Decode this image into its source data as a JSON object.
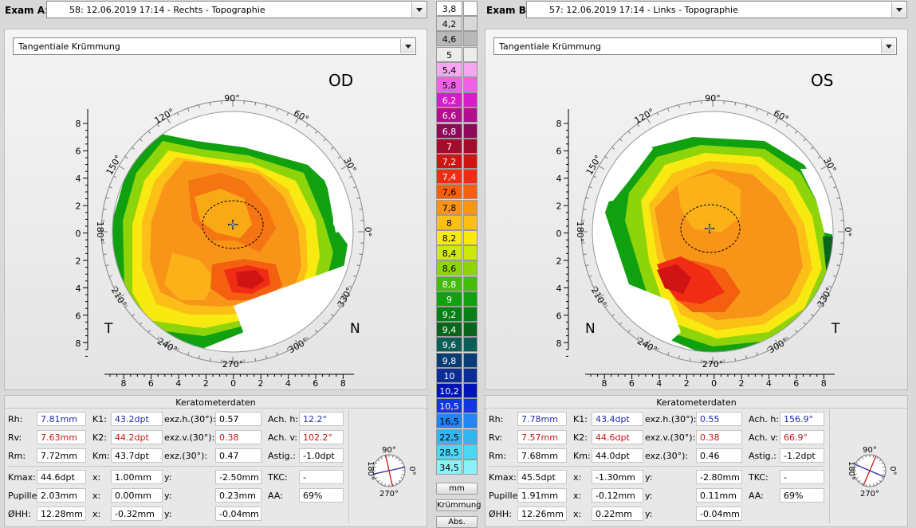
{
  "examA": {
    "label": "Exam A:",
    "value": "58: 12.06.2019 17:14 - Rechts - Topographie"
  },
  "examB": {
    "label": "Exam B:",
    "value": "57: 12.06.2019 17:14 - Links - Topographie"
  },
  "mapA": {
    "type": "Tangentiale Krümmung",
    "eye": "OD",
    "left_corner": "T",
    "right_corner": "N"
  },
  "mapB": {
    "type": "Tangentiale Krümmung",
    "eye": "OS",
    "left_corner": "N",
    "right_corner": "T"
  },
  "angles": {
    "a90": "90°",
    "a60": "60°",
    "a30": "30°",
    "a0": "0°",
    "a330": "330°",
    "a300": "300°",
    "a270": "270°",
    "a240": "240°",
    "a210": "210°",
    "a180": "180°",
    "a150": "150°",
    "a120": "120°"
  },
  "axis_ticks": [
    "8",
    "6",
    "4",
    "2",
    "0",
    "2",
    "4",
    "6",
    "8"
  ],
  "scale": [
    {
      "v": "3,8",
      "c": "#ffffff"
    },
    {
      "v": "4,2",
      "c": "#d8d8d8"
    },
    {
      "v": "4,6",
      "c": "#b8b8b8"
    },
    {
      "v": "5",
      "c": "#ececec"
    },
    {
      "v": "5,4",
      "c": "#f7a6f0"
    },
    {
      "v": "5,8",
      "c": "#f060e8"
    },
    {
      "v": "6,2",
      "c": "#d81cc8"
    },
    {
      "v": "6,6",
      "c": "#b0108c"
    },
    {
      "v": "6,8",
      "c": "#8c0a58"
    },
    {
      "v": "7",
      "c": "#a00c2c"
    },
    {
      "v": "7,2",
      "c": "#d01414"
    },
    {
      "v": "7,4",
      "c": "#f02c14"
    },
    {
      "v": "7,6",
      "c": "#f46010"
    },
    {
      "v": "7,8",
      "c": "#f89418"
    },
    {
      "v": "8",
      "c": "#fbbf18"
    },
    {
      "v": "8,2",
      "c": "#f8ea10"
    },
    {
      "v": "8,4",
      "c": "#cde80c"
    },
    {
      "v": "8,6",
      "c": "#8ed40a"
    },
    {
      "v": "8,8",
      "c": "#44bc08"
    },
    {
      "v": "9",
      "c": "#10a010"
    },
    {
      "v": "9,2",
      "c": "#0a7c18"
    },
    {
      "v": "9,4",
      "c": "#0a641c"
    },
    {
      "v": "9,6",
      "c": "#0c5c58"
    },
    {
      "v": "9,8",
      "c": "#0a3c74"
    },
    {
      "v": "10",
      "c": "#0a2c94"
    },
    {
      "v": "10,2",
      "c": "#0014b4"
    },
    {
      "v": "10,5",
      "c": "#1038e0"
    },
    {
      "v": "16,5",
      "c": "#2484f0"
    },
    {
      "v": "22,5",
      "c": "#34b4f0"
    },
    {
      "v": "28,5",
      "c": "#4cd8f4"
    },
    {
      "v": "34,5",
      "c": "#8cf0f8"
    }
  ],
  "buttons": {
    "mm": "mm",
    "kruemmung": "Krümmung",
    "abs": "Abs."
  },
  "keratoA": {
    "title": "Keratometerdaten",
    "Rh_l": "Rh:",
    "Rh": "7.81mm",
    "Rv_l": "Rv:",
    "Rv": "7.63mm",
    "Rm_l": "Rm:",
    "Rm": "7.72mm",
    "K1_l": "K1:",
    "K1": "43.2dpt",
    "K2_l": "K2:",
    "K2": "44.2dpt",
    "Km_l": "Km:",
    "Km": "43.7dpt",
    "exzh_l": "exz.h.(30°):",
    "exzh": "0.57",
    "exzv_l": "exz.v.(30°):",
    "exzv": "0.38",
    "exz_l": "exz.(30°):",
    "exz": "0.47",
    "achh_l": "Ach. h:",
    "achh": "12.2°",
    "achv_l": "Ach. v:",
    "achv": "102.2°",
    "astig_l": "Astig.:",
    "astig": "-1.0dpt",
    "kmax_l": "Kmax:",
    "kmax": "44.6dpt",
    "kmax_x_l": "x:",
    "kmax_x": "1.00mm",
    "kmax_y_l": "y:",
    "kmax_y": "-2.50mm",
    "pup_l": "Pupille:",
    "pup": "2.03mm",
    "pup_x_l": "x:",
    "pup_x": "0.00mm",
    "pup_y_l": "y:",
    "pup_y": "0.23mm",
    "hh_l": "ØHH:",
    "hh": "12.28mm",
    "hh_x_l": "x:",
    "hh_x": "-0.32mm",
    "hh_y_l": "y:",
    "hh_y": "-0.04mm",
    "tkc_l": "TKC:",
    "tkc": "-",
    "aa_l": "AA:",
    "aa": "69%",
    "compass": {
      "n": "90°",
      "s": "270°",
      "w": "180°",
      "e": "0°"
    }
  },
  "keratoB": {
    "title": "Keratometerdaten",
    "Rh_l": "Rh:",
    "Rh": "7.78mm",
    "Rv_l": "Rv:",
    "Rv": "7.57mm",
    "Rm_l": "Rm:",
    "Rm": "7.68mm",
    "K1_l": "K1:",
    "K1": "43.4dpt",
    "K2_l": "K2:",
    "K2": "44.6dpt",
    "Km_l": "Km:",
    "Km": "44.0dpt",
    "exzh_l": "exz.h.(30°):",
    "exzh": "0.55",
    "exzv_l": "exz.v.(30°):",
    "exzv": "0.38",
    "exz_l": "exz.(30°):",
    "exz": "0.46",
    "achh_l": "Ach. h:",
    "achh": "156.9°",
    "achv_l": "Ach. v:",
    "achv": "66.9°",
    "astig_l": "Astig.:",
    "astig": "-1.2dpt",
    "kmax_l": "Kmax:",
    "kmax": "45.5dpt",
    "kmax_x_l": "x:",
    "kmax_x": "-1.30mm",
    "kmax_y_l": "y:",
    "kmax_y": "-2.80mm",
    "pup_l": "Pupille:",
    "pup": "1.91mm",
    "pup_x_l": "x:",
    "pup_x": "-0.12mm",
    "pup_y_l": "y:",
    "pup_y": "0.11mm",
    "hh_l": "ØHH:",
    "hh": "12.26mm",
    "hh_x_l": "x:",
    "hh_x": "0.22mm",
    "hh_y_l": "y:",
    "hh_y": "-0.04mm",
    "tkc_l": "TKC:",
    "tkc": "-",
    "aa_l": "AA:",
    "aa": "69%",
    "compass": {
      "n": "90°",
      "s": "270°",
      "w": "180°",
      "e": "0°"
    }
  }
}
